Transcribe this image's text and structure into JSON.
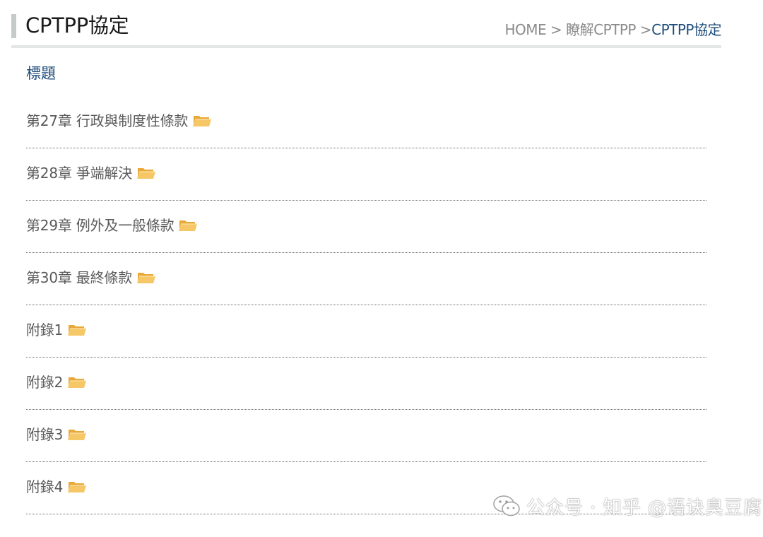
{
  "header": {
    "title": "CPTPP協定",
    "breadcrumb": {
      "home": "HOME",
      "sep1": " > ",
      "section": "瞭解CPTPP",
      "sep2": " >",
      "current": "CPTPP協定"
    }
  },
  "list": {
    "heading": "標題",
    "items": [
      {
        "label": "第27章 行政與制度性條款",
        "icon": "folder-icon"
      },
      {
        "label": "第28章 爭端解決",
        "icon": "folder-icon"
      },
      {
        "label": "第29章 例外及一般條款",
        "icon": "folder-icon"
      },
      {
        "label": "第30章 最終條款",
        "icon": "folder-icon"
      },
      {
        "label": "附錄1",
        "icon": "folder-icon"
      },
      {
        "label": "附錄2",
        "icon": "folder-icon"
      },
      {
        "label": "附錄3",
        "icon": "folder-icon"
      },
      {
        "label": "附錄4",
        "icon": "folder-icon"
      }
    ]
  },
  "watermark": {
    "text": "公众号 · 知乎 @语诀臭豆腐",
    "icon": "wechat-icon"
  },
  "colors": {
    "title_text": "#1a1a1a",
    "breadcrumb_link": "#8b8b8b",
    "breadcrumb_current": "#1e4d7b",
    "heading": "#1e4d7b",
    "item_text": "#5a5a5a",
    "folder": "#f6c767"
  }
}
